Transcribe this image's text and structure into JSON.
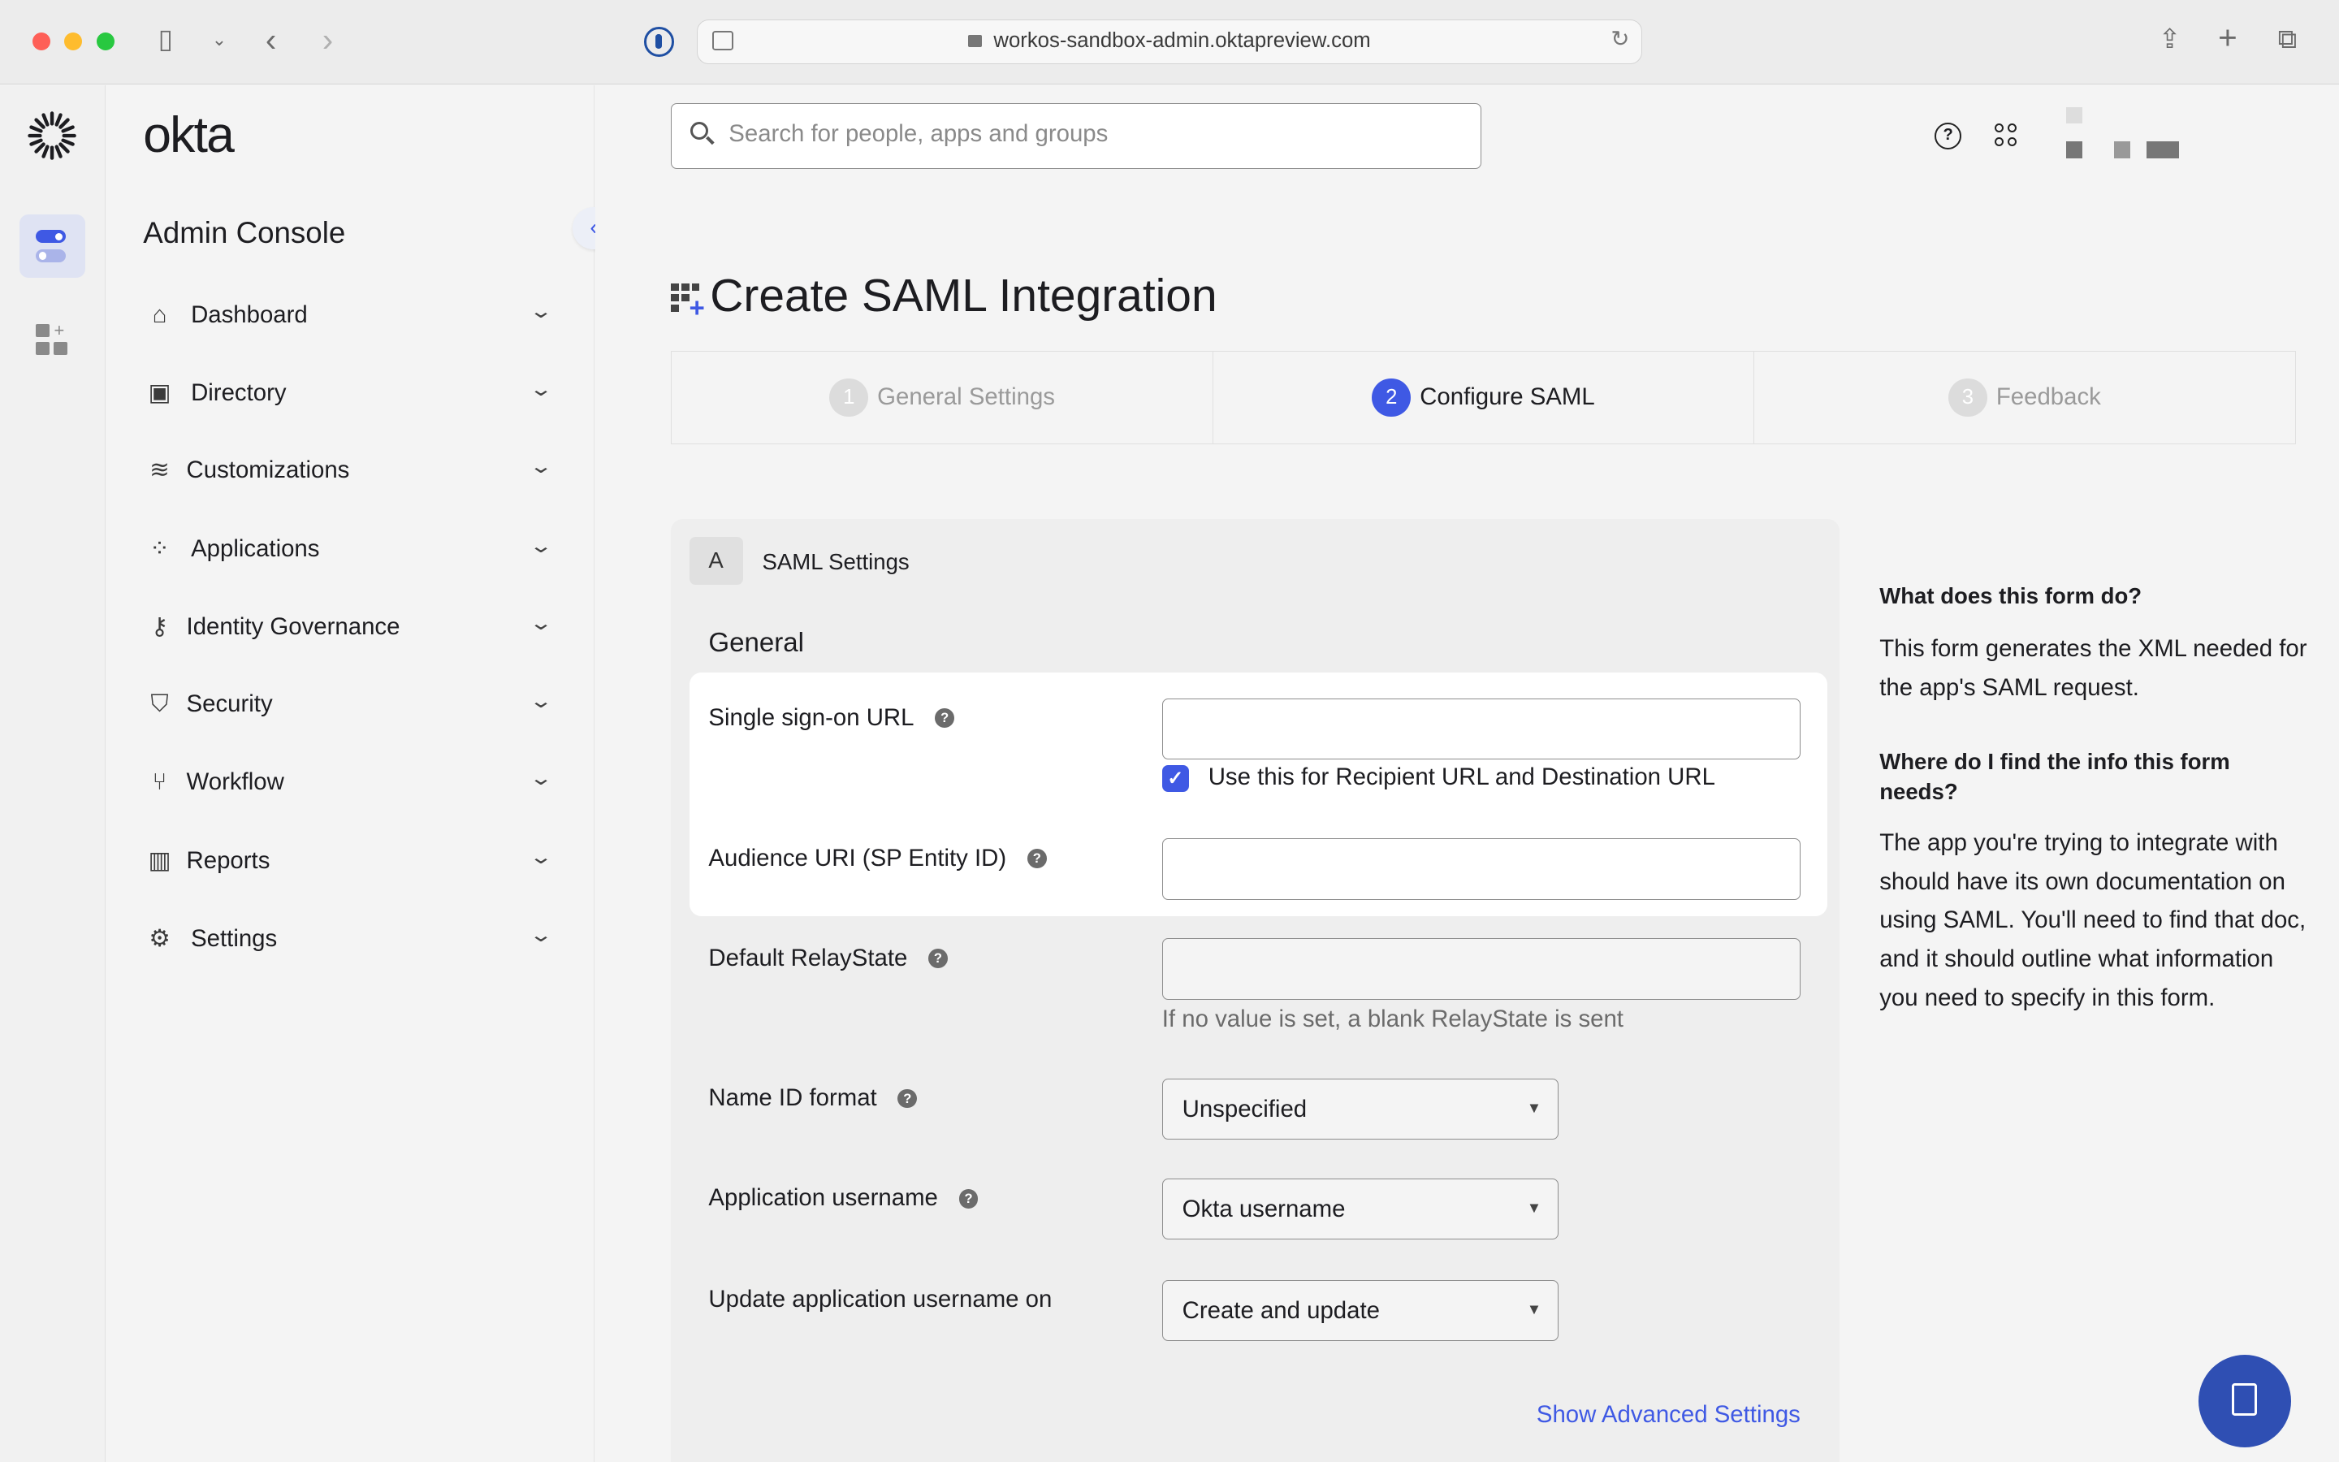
{
  "browser": {
    "url": "workos-sandbox-admin.oktapreview.com"
  },
  "sidebar": {
    "logo_text": "okta",
    "title": "Admin Console",
    "items": [
      {
        "label": "Dashboard",
        "icon": "home-icon"
      },
      {
        "label": "Directory",
        "icon": "directory-icon"
      },
      {
        "label": "Customizations",
        "icon": "sliders-icon"
      },
      {
        "label": "Applications",
        "icon": "apps-grid-icon"
      },
      {
        "label": "Identity Governance",
        "icon": "key-icon"
      },
      {
        "label": "Security",
        "icon": "shield-icon"
      },
      {
        "label": "Workflow",
        "icon": "workflow-icon"
      },
      {
        "label": "Reports",
        "icon": "bar-chart-icon"
      },
      {
        "label": "Settings",
        "icon": "gear-icon"
      }
    ]
  },
  "header": {
    "search_placeholder": "Search for people, apps and groups"
  },
  "page": {
    "title": "Create SAML Integration",
    "steps": [
      {
        "num": "1",
        "label": "General Settings",
        "active": false
      },
      {
        "num": "2",
        "label": "Configure SAML",
        "active": true
      },
      {
        "num": "3",
        "label": "Feedback",
        "active": false
      }
    ]
  },
  "form": {
    "section_badge": "A",
    "section_title": "SAML Settings",
    "group_title": "General",
    "sso_label": "Single sign-on URL",
    "sso_value": "",
    "recipient_check_label": "Use this for Recipient URL and Destination URL",
    "recipient_checked": true,
    "audience_label": "Audience URI (SP Entity ID)",
    "audience_value": "",
    "relay_label": "Default RelayState",
    "relay_value": "",
    "relay_hint": "If no value is set, a blank RelayState is sent",
    "nameid_label": "Name ID format",
    "nameid_value": "Unspecified",
    "appuser_label": "Application username",
    "appuser_value": "Okta username",
    "update_label": "Update application username on",
    "update_value": "Create and update",
    "advanced_link": "Show Advanced Settings"
  },
  "help": {
    "q1": "What does this form do?",
    "a1": "This form generates the XML needed for the app's SAML request.",
    "q2": "Where do I find the info this form needs?",
    "a2": "The app you're trying to integrate with should have its own documentation on using SAML. You'll need to find that doc, and it should outline what information you need to specify in this form."
  },
  "colors": {
    "accent": "#3f59e4",
    "fab": "#2f4fb3"
  }
}
